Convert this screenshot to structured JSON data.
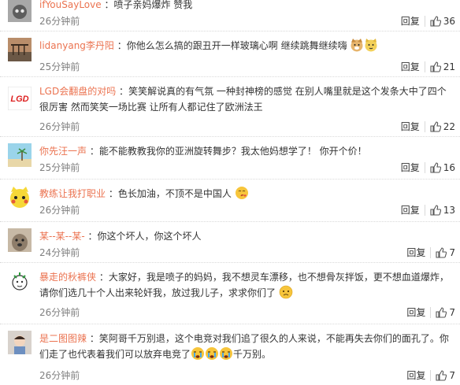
{
  "comments": [
    {
      "user": "ifYouSayLove",
      "text": "喷子亲妈爆炸 赞我",
      "time": "26分钟前",
      "reply": "回复",
      "likes": "36"
    },
    {
      "user": "lidanyang李丹阳",
      "text": "你他么怎么搞的跟丑开一样玻璃心啊 继续跳舞继续嗨",
      "time": "25分钟前",
      "reply": "回复",
      "likes": "21"
    },
    {
      "user": "LGD会翻盘的对吗",
      "text": "笑笑解说真的有气氛 一种封神榜的感觉 在别人嘴里就是这个发条大中了四个 很厉害 然而笑笑一场比赛 让所有人都记住了欧洲法王",
      "time": "26分钟前",
      "reply": "回复",
      "likes": "22"
    },
    {
      "user": "你先汪一声",
      "text": "能不能教教我你的亚洲旋转舞步？我太他妈想学了！ 你开个价！",
      "time": "25分钟前",
      "reply": "回复",
      "likes": "16"
    },
    {
      "user": "教练让我打职业",
      "text": "色长加油，不顶不是中国人",
      "time": "26分钟前",
      "reply": "回复",
      "likes": "13"
    },
    {
      "user": "某--某--某-",
      "text": "你这个坏人，你这个坏人",
      "time": "24分钟前",
      "reply": "回复",
      "likes": "7"
    },
    {
      "user": "暴走的秋裤侠",
      "text": "大家好，我是喷子的妈妈，我不想灵车漂移，也不想骨灰拌饭，更不想血道爆炸，请你们选几十个人出来轮奸我，放过我儿子，求求你们了",
      "time": "26分钟前",
      "reply": "回复",
      "likes": "7"
    },
    {
      "user": "是二图图辣",
      "text": "笑阿哥千万别退，这个电竞对我们追了很久的人来说，不能再失去你们的面孔了。你们走了也代表着我们可以放弃电竞了",
      "text2": "千万别。",
      "time": "26分钟前",
      "reply": "回复",
      "likes": "7"
    }
  ],
  "colors": {
    "username": "#eb7350",
    "meta": "#808080",
    "text": "#333333",
    "divider": "#d9d9d9"
  }
}
